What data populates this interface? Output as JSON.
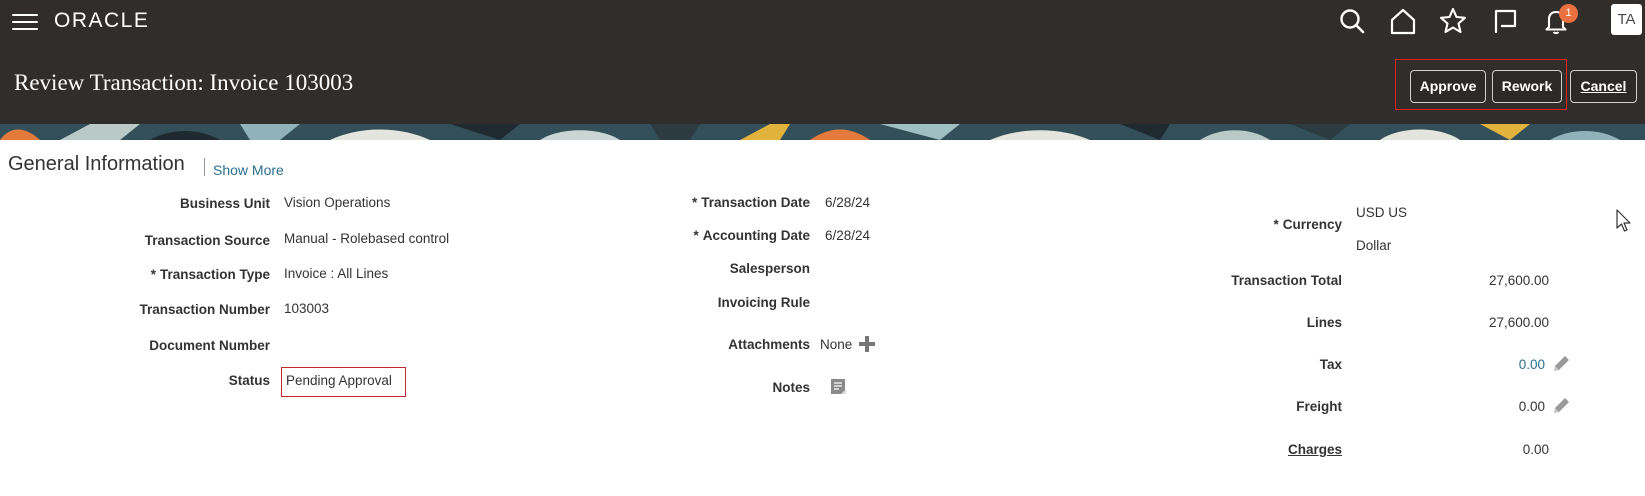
{
  "header": {
    "brand": "ORACLE",
    "avatar_initials": "TA",
    "notification_count": "1",
    "page_title": "Review Transaction: Invoice 103003",
    "buttons": {
      "approve": "Approve",
      "rework": "Rework",
      "cancel": "Cancel"
    },
    "icons": [
      "menu-icon",
      "search-icon",
      "home-icon",
      "star-icon",
      "flag-icon",
      "bell-icon"
    ]
  },
  "section": {
    "title": "General Information",
    "show_more": "Show More"
  },
  "left_fields": [
    {
      "label": "Business Unit",
      "value": "Vision Operations"
    },
    {
      "label": "Transaction Source",
      "value": "Manual - Rolebased control"
    },
    {
      "label": "Transaction Type",
      "value": "Invoice : All Lines",
      "required": true
    },
    {
      "label": "Transaction Number",
      "value": "103003"
    },
    {
      "label": "Document Number",
      "value": ""
    },
    {
      "label": "Status",
      "value": "Pending Approval"
    }
  ],
  "middle_fields": [
    {
      "label": "Transaction Date",
      "value": "6/28/24",
      "required": true
    },
    {
      "label": "Accounting Date",
      "value": "6/28/24",
      "required": true
    },
    {
      "label": "Salesperson",
      "value": ""
    },
    {
      "label": "Invoicing Rule",
      "value": ""
    },
    {
      "label": "Attachments",
      "value": "None"
    },
    {
      "label": "Notes",
      "value": ""
    }
  ],
  "right_fields": {
    "currency": {
      "label": "Currency",
      "value_line1": "USD US",
      "value_line2": "Dollar",
      "required": true
    },
    "transaction_total": {
      "label": "Transaction Total",
      "value": "27,600.00"
    },
    "lines": {
      "label": "Lines",
      "value": "27,600.00"
    },
    "tax": {
      "label": "Tax",
      "value": "0.00"
    },
    "freight": {
      "label": "Freight",
      "value": "0.00"
    },
    "charges": {
      "label": "Charges",
      "value": "0.00"
    }
  },
  "colors": {
    "header_bg": "#312d2a",
    "link": "#2a6e8f",
    "highlight": "#e0241d",
    "badge": "#e8713f"
  }
}
